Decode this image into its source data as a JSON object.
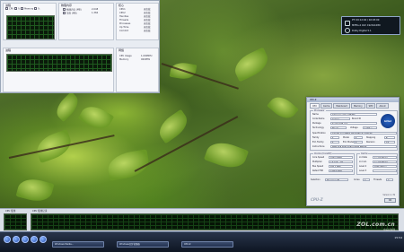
{
  "task_manager": {
    "left_header": "进程",
    "checks": [
      "CPU",
      "%",
      "Memory",
      "%"
    ],
    "pane2_title": "物理内存",
    "pane2_rows": [
      "物理内存 (MB)",
      "可用 (MB)"
    ],
    "pane2_values": [
      "2,048",
      "1,384"
    ],
    "pane3_title": "核心",
    "pane3_rows": [
      "CPU1",
      "CPU2",
      "Handles",
      "Threads",
      "Processes",
      "Up Time",
      "Commit"
    ],
    "pane3_values": [
      "无负载",
      "无负载",
      "无负载",
      "无负载",
      "无负载",
      "无负载",
      "无负载"
    ],
    "lower_left_title": "进程",
    "lower_right_title": "网络",
    "lower_right_rows": [
      "CPU Usage",
      "Memory"
    ],
    "lower_right_values": [
      "1,000MHz",
      "000MHz"
    ]
  },
  "media_panel": {
    "line1": "PT: 00:12:04 / 02:03:00",
    "line2": "MPEG-4 AVC 1920x1080",
    "line3": "Dolby Digital 5.1"
  },
  "cpuz": {
    "title": "CPU-Z",
    "tabs": [
      "CPU",
      "Cache",
      "Mainboard",
      "Memory",
      "SPD",
      "About"
    ],
    "processor_group": "Processor",
    "name_label": "Name",
    "name_value": "Intel Core 2 Duo E6750",
    "code_label": "Code Name",
    "code_value": "Conroe",
    "brand_id_label": "Brand ID",
    "package_label": "Package",
    "package_value": "Socket 775 LGA",
    "tech_label": "Technology",
    "tech_value": "65 nm",
    "voltage_label": "Voltage",
    "voltage_value": "1.300 v",
    "spec_label": "Specification",
    "spec_value": "Intel(R) Core(TM)2 CPU 6750 @ 2.66GHz",
    "family_label": "Family",
    "family_value": "6",
    "model_label": "Model",
    "model_value": "F",
    "stepping_label": "Stepping",
    "stepping_value": "B",
    "extfam_label": "Ext. Family",
    "extfam_value": "6",
    "extmod_label": "Ext. Model",
    "extmod_value": "F",
    "rev_label": "Revision",
    "rev_value": "G0",
    "instr_label": "Instructions",
    "instr_value": "MMX SSE SSE2 SSE3 SSSE3 EM64T",
    "clocks_group": "Clocks (Core#0)",
    "core_speed_label": "Core Speed",
    "core_speed_value": "1992.7 MHz",
    "multiplier_label": "Multiplier",
    "multiplier_value": "x 6.0 (6 - 10)",
    "bus_label": "Bus Speed",
    "bus_value": "332.1 MHz",
    "fsb_label": "Rated FSB",
    "fsb_value": "1328.5 MHz",
    "cache_group": "Cache",
    "l1d_label": "L1 Data",
    "l1d_value": "2 x 32 KBytes",
    "l1i_label": "L1 Inst.",
    "l1i_value": "2 x 32 KBytes",
    "l2_label": "Level 2",
    "l2_value": "4096 KBytes",
    "l3_label": "Level 3",
    "selection_label": "Selection",
    "selection_value": "Processor #1",
    "cores_label": "Cores",
    "cores_value": "2",
    "threads_label": "Threads",
    "threads_value": "2",
    "version": "Version 1.39",
    "ok_label": "OK",
    "brand": "CPU-Z",
    "logo_text": "intel"
  },
  "performance": {
    "cpu_label": "CPU 使用",
    "history_label": "CPU 使用记录"
  },
  "taskbar": {
    "buttons": [
      "Windows Media...",
      "Windows任务管理器",
      "CPU-Z"
    ],
    "time": "15:54"
  },
  "watermark": {
    "main": "ZOL.com.cn",
    "sub": "中关村在线"
  }
}
